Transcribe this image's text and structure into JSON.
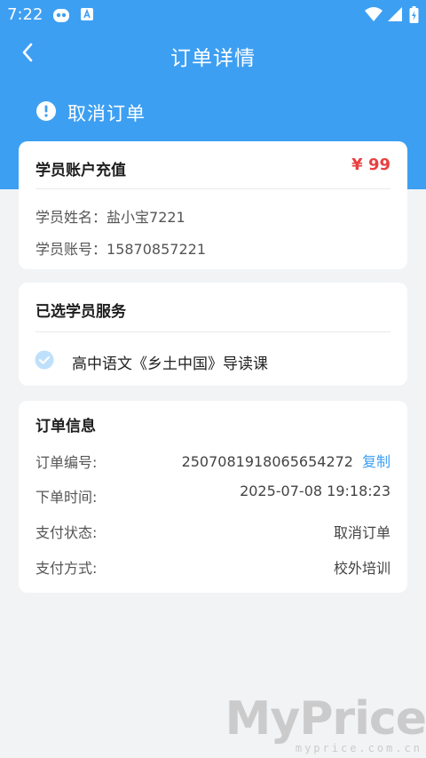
{
  "statusbar": {
    "time": "7:22"
  },
  "topbar": {
    "title": "订单详情"
  },
  "order_status": {
    "label": "取消订单"
  },
  "account_card": {
    "title": "学员账户充值",
    "price": "¥ 99",
    "rows": [
      {
        "label": "学员姓名：",
        "value": "盐小宝7221"
      },
      {
        "label": "学员账号：",
        "value": "15870857221"
      }
    ]
  },
  "service_card": {
    "title": "已选学员服务",
    "items": [
      {
        "label": "高中语文《乡土中国》导读课"
      }
    ]
  },
  "order_card": {
    "title": "订单信息",
    "order_no_label": "订单编号:",
    "order_no": "2507081918065654272",
    "copy_label": "复制",
    "time_label": "下单时间:",
    "time_value": "2025-07-08 19:18:23",
    "pay_status_label": "支付状态:",
    "pay_status_value": "取消订单",
    "pay_method_label": "支付方式:",
    "pay_method_value": "校外培训"
  },
  "watermark": {
    "brand": "MyPrice",
    "url": "myprice.com.cn"
  },
  "colors": {
    "primary": "#3d9ff2",
    "price": "#e84040",
    "background": "#f2f3f5"
  }
}
